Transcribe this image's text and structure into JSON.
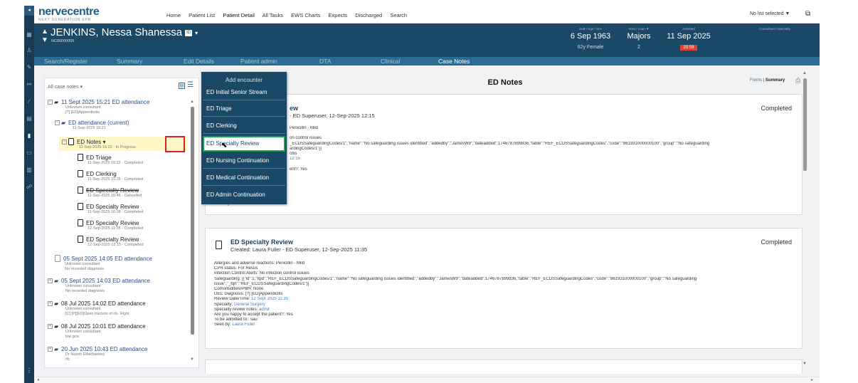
{
  "app": {
    "logo_main": "nervecentre",
    "logo_sub": "NEXT GENERATION EPR"
  },
  "nav": {
    "links": [
      "Home",
      "Patient List",
      "Patient Detail",
      "All Tasks",
      "EWS Charts",
      "Expects",
      "Discharged",
      "Search"
    ],
    "list_selector": "No list selected ▼"
  },
  "patient": {
    "name": "JENKINS, Nessa Shanessa",
    "id_badge": "ID",
    "nhs": "NC00000005",
    "dob_header": "DoB / Age / Sex",
    "dob": "6 Sep 1963",
    "age_sex": "62y Female",
    "area_header": "Area / Loan ▼",
    "area": "Majors",
    "area_sub": "2",
    "admitted_header": "Admitted",
    "admitted": "11 Sep 2025",
    "admitted_time": "20:59",
    "consultant_header": "Consultant / Specialty"
  },
  "tabs": [
    "Search/Register",
    "Summary",
    "Edit Details",
    "Patient admin",
    "DTA",
    "Clinical",
    "Case Notes"
  ],
  "case_panel": {
    "filter": "All case notes ▾",
    "items": [
      {
        "title": "11 Sept 2025 15:21 ED attendance",
        "l1": "Unknown consultant",
        "l2": "[?] [ED]Appendicitis"
      },
      {
        "title": "ED attendance (current)",
        "l1": "11-Sep-2025 15:21"
      },
      {
        "title": "ED Notes ▾",
        "l1": "11-Sep-2025 15:22 - In Progress"
      },
      {
        "title": "ED Triage",
        "l1": "11-Sep-2025 15:22 - Completed"
      },
      {
        "title": "ED Clerking",
        "l1": "11-Sep-2025 15:25 - Completed"
      },
      {
        "title": "ED Specialty Review",
        "l1": "11-Sep-2025 15:46 - Cancelled"
      },
      {
        "title": "ED Specialty Review",
        "l1": "11-Sep-2025 16:08 - Completed"
      },
      {
        "title": "ED Specialty Review",
        "l1": "12-Sep-2025 11:35 - Completed"
      },
      {
        "title": "ED Specialty Review",
        "l1": "12-Sep-2025 12:15 - Completed"
      },
      {
        "title": "05 Sept 2025 14:05 ED attendance",
        "l1": "Unknown consultant",
        "l2": "No recorded diagnosis"
      },
      {
        "title": "05 Sept 2025 14:03 ED attendance",
        "l1": "Unknown consultant",
        "l2": "No recorded diagnosis"
      },
      {
        "title": "08 Jul 2025 14:02 ED attendance",
        "l1": "Unknown consultant",
        "l2": "[C] [P][ED]Open fracture of rib- Right"
      },
      {
        "title": "08 Jul 2025 10:01 ED attendance",
        "l1": "Unknown consultant",
        "l2": "low gca"
      },
      {
        "title": "20 Jun 2025 10:43 ED attendance",
        "l1": "Dr Nazeh Elfakhaeeny",
        "l2": "rfc"
      }
    ]
  },
  "dropdown": {
    "title": "Add encounter",
    "items": [
      "ED Initial Senior Stream",
      "ED Triage",
      "ED Clerking",
      "ED Specialty Review",
      "ED Nursing Continuation",
      "ED Medical Continuation",
      "ED Admin Continuation"
    ]
  },
  "notes": {
    "title": "ED Notes",
    "forms": "Forms",
    "summary": "Summary",
    "card1": {
      "title_visible": "ew",
      "created_visible": "- ED Superuser, 12-Sep-2025 12:15",
      "status": "Completed",
      "lines": [
        "Penicillin - Mild",
        "",
        "on control issues",
        "_ECDSSafeguardingCodes/1\",\"name\":\"No safeguarding issues identified\",\"addedby\":\"JamesW9\",\"dateadded\":1746787899836,\"table\":\"REF_ECDSSafeguardingCodes\",\"code\":\"861931000000100\",\"group\":\"No safeguarding",
        "ardingCodes/1\"}]",
        "citis",
        "12:15",
        "",
        "ent?: Yes",
        ""
      ],
      "seen_label": "Seen by:",
      "seen_val": "Laura Fuller"
    },
    "card2": {
      "title": "ED Specialty Review",
      "created": "Created: Laura Fuller - ED Superuser, 12-Sep-2025 11:35",
      "status": "Completed",
      "l_allergy": "Allergies and adverse reactions: Penicillin - Mild",
      "l_cpr": "CPR status: For Resus",
      "l_infect": "Infection Control Alerts: No infection control issues",
      "l_safe1": "Safeguarding: [{\"id\":1,\"fqid\":\"REF_ECDSSafeguardingCodes/1\",\"name\":\"No safeguarding issues identified\",\"addedby\":\"JamesW9\",\"dateadded\":1746787899836,\"table\":\"REF_ECDSSafeguardingCodes\",\"code\":\"861931000000100\",\"group\":\"No safeguarding",
      "l_safe2": "issue\",\"_fqn\":\"REF_ECDSSafeguardingCodes/1\"}]",
      "l_comorb": "Comorbidities/PMH: None",
      "l_uec": "UEC Diagnosis: [?] [ED]Appendicitis",
      "l_review_label": "Review Date/Time:",
      "l_review_val": "12 Sept 2025 11:35",
      "l_spec_label": "Specialty:",
      "l_spec_val": "General Surgery",
      "l_notes_label": "Specialty review notes:",
      "l_notes_val": "admit",
      "l_happy": "Are you happy to accept the patient?: Yes",
      "l_admit": "To be admitted to:: sau",
      "l_seen_label": "Seen by:",
      "l_seen_val": "Laura Fuller"
    }
  },
  "colors": {
    "banner": "#1c4868",
    "tabbar": "#2a6b93",
    "highlight_border": "#19a04a",
    "red_box": "#e02020",
    "time_badge": "#d9452f"
  },
  "icons": [
    "grid-icon",
    "person-icon",
    "pen-icon",
    "network-icon",
    "bed-icon",
    "list-icon",
    "flask-icon",
    "calendar-icon",
    "printer-icon",
    "window-icon",
    "folder-icon",
    "document-icon",
    "mouse-cursor-icon"
  ]
}
